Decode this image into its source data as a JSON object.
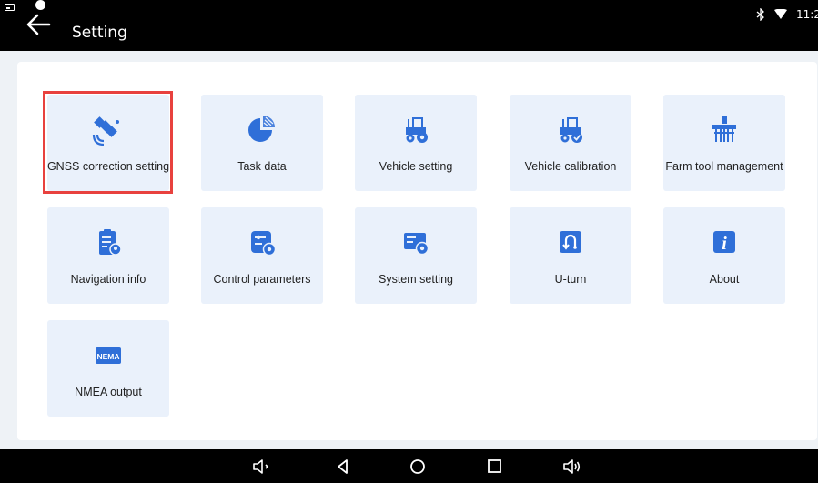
{
  "header": {
    "title": "Setting",
    "clock": "11:2"
  },
  "tiles": [
    {
      "label": "GNSS correction setting",
      "icon": "satellite-icon",
      "selected": true
    },
    {
      "label": "Task data",
      "icon": "pie-chart-icon"
    },
    {
      "label": "Vehicle setting",
      "icon": "tractor-icon"
    },
    {
      "label": "Vehicle calibration",
      "icon": "tractor-check-icon"
    },
    {
      "label": "Farm tool management",
      "icon": "farm-tool-icon"
    },
    {
      "label": "Navigation info",
      "icon": "nav-info-icon"
    },
    {
      "label": "Control parameters",
      "icon": "control-params-icon"
    },
    {
      "label": "System setting",
      "icon": "system-setting-icon"
    },
    {
      "label": "U-turn",
      "icon": "u-turn-icon"
    },
    {
      "label": "About",
      "icon": "info-icon"
    },
    {
      "label": "NMEA output",
      "icon": "nema-icon",
      "icon_text": "NEMA"
    }
  ],
  "colors": {
    "icon_blue": "#2f6fd8",
    "tile_bg": "#eaf1fb",
    "selected_border": "#e8413e",
    "page_bg": "#eef2f6"
  }
}
